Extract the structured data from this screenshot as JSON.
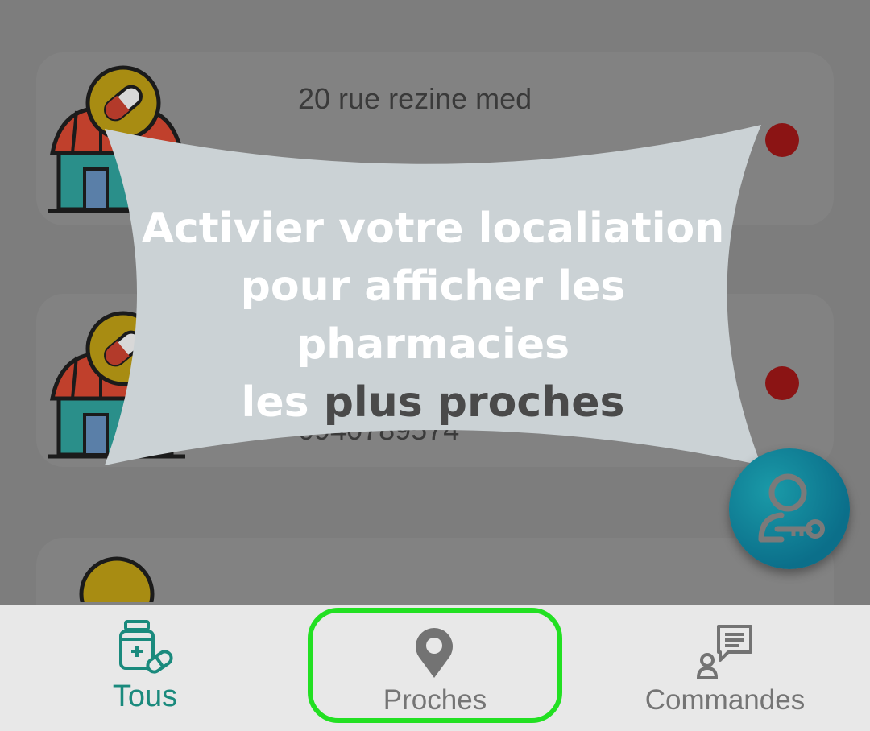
{
  "list": {
    "cards": [
      {
        "address": "20 rue rezine med",
        "phone": ""
      },
      {
        "address": "",
        "phone": "0940789574"
      },
      {
        "address": "",
        "phone": ""
      }
    ]
  },
  "tooltip": {
    "line1": "Activier votre localiation",
    "line2": "pour afficher les pharmacies",
    "line3_part1": "les ",
    "line3_part2": "plus proches"
  },
  "fab": {
    "icon": "user-key-icon"
  },
  "bottom_nav": {
    "items": [
      {
        "label": "Tous",
        "icon": "medicine-bottle-icon",
        "active": true
      },
      {
        "label": "Proches",
        "icon": "location-pin-icon",
        "active": false
      },
      {
        "label": "Commandes",
        "icon": "user-chat-icon",
        "active": false
      }
    ]
  },
  "colors": {
    "overlay": "#7d7d7d",
    "accent": "#1a8a7d",
    "highlight": "#22e022",
    "status_dot": "#8b1414",
    "fab": "#0b6f8a"
  }
}
